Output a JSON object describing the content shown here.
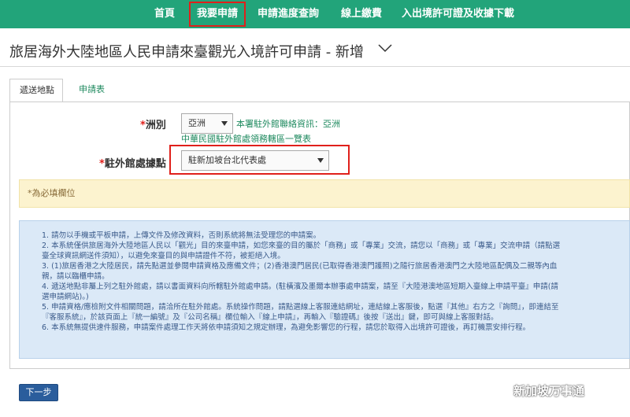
{
  "nav": {
    "items": [
      {
        "label": "首頁"
      },
      {
        "label": "我要申請"
      },
      {
        "label": "申請進度查詢"
      },
      {
        "label": "線上繳費"
      },
      {
        "label": "入出境許可證及收據下載"
      }
    ]
  },
  "page": {
    "title": "旅居海外大陸地區人民申請來臺觀光入境許可申請 - 新增"
  },
  "tabs": [
    {
      "label": "遞送地點"
    },
    {
      "label": "申請表"
    }
  ],
  "form": {
    "continent_label": "洲別",
    "continent_value": "亞洲",
    "office_info": "本署駐外館聯絡資訊：亞洲",
    "office_list_link": "中華民國駐外館處領務轄區一覽表",
    "office_label": "駐外館處據點",
    "office_value": "駐新加坡台北代表處",
    "required_marker": "*",
    "required_note": "*為必填欄位"
  },
  "notices": [
    "1. 請勿以手機或平板申請，上傳文件及修改資料，否則系統將無法受理您的申請案。",
    "2. 本系統僅供旅居海外大陸地區人民以「觀光」目的來臺申請，如您來臺的目的屬於「商務」或「專業」交流，請您以「商務」或「專業」交流申請（請點選",
    "   臺全球資訊網送件須知），以避免來臺目的與申請證件不符，被拒絕入境。",
    "3. (1)旅居香港之大陸居民，請先點選並參閱申請資格及應備文件；(2)香港澳門居民(已取得香港澳門護照)之隨行旅居香港澳門之大陸地區配偶及二親等內血",
    "   親，請以臨櫃申請。",
    "4. 遞送地點非屬上列之駐外館處，請以書面資料向所轄駐外館處申請。(駐橫濱及墨爾本辦事處申請案，請至『大陸港澳地區短期入臺線上申請平臺』申請(請",
    "   選申請網站)。)",
    "5. 申請資格/應檢附文件相關問題，請洽所在駐外館處。系統操作問題，請點選線上客服連結網址，連結線上客服後，點選『其他』右方之『詢問』，即連結至",
    "   『客服系統』，於該頁面上『統一編號』及『公司名稱』欄位輸入『線上申請』，再輸入『驗證碼』後按『送出』鍵，即可與線上客服對話。",
    "6. 本系統無提供速件服務，申請案件處理工作天將依申請須知之規定辦理，為避免影響您的行程，請您於取得入出境許可證後，再訂機票安排行程。"
  ],
  "buttons": {
    "next": "下一步"
  },
  "watermark": {
    "text": "新加坡万事通",
    "icon": "wechat-icon"
  },
  "colors": {
    "nav_bg": "#22a47a",
    "highlight_red": "#e0201b",
    "link_green": "#1f8a5f",
    "button_blue": "#2a5d9c"
  }
}
